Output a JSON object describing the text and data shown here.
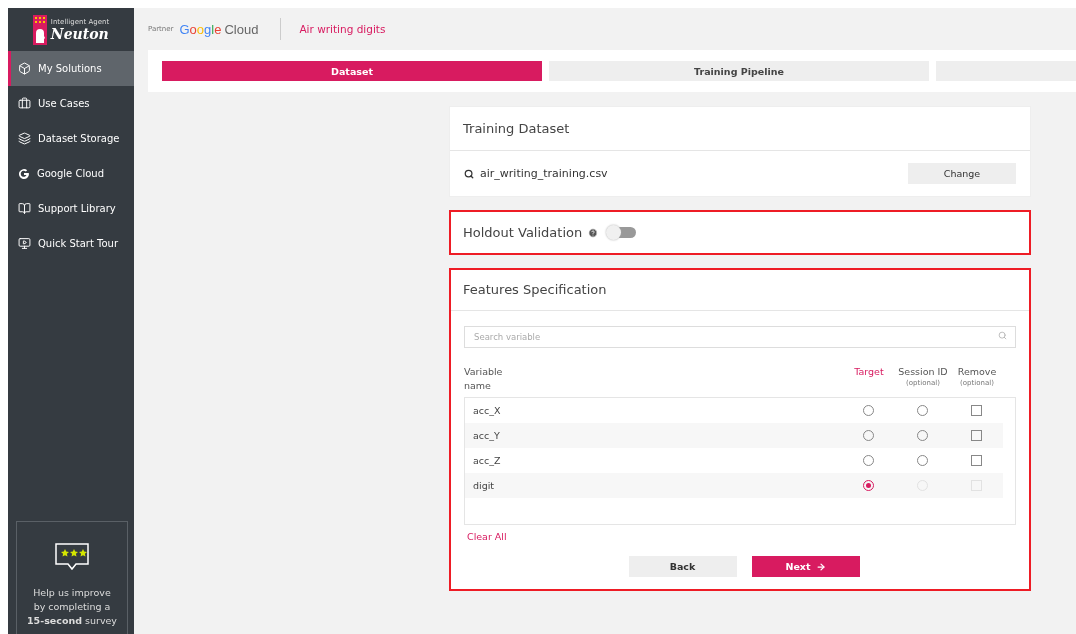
{
  "brand": {
    "tagline": "Intelligent Agent",
    "name": "Neuton"
  },
  "sidebar": {
    "items": [
      {
        "label": "My Solutions",
        "selected": true
      },
      {
        "label": "Use Cases",
        "selected": false
      },
      {
        "label": "Dataset Storage",
        "selected": false
      },
      {
        "label": "Google Cloud",
        "selected": false
      },
      {
        "label": "Support Library",
        "selected": false
      },
      {
        "label": "Quick Start Tour",
        "selected": false
      }
    ],
    "survey": {
      "text": "Help us improve by completing a **15-second** survey"
    }
  },
  "header": {
    "partner": "Partner",
    "partner_logo": "Google",
    "partner_product": "Cloud",
    "project": "Air writing digits"
  },
  "steps": [
    {
      "label": "Dataset",
      "selected": true
    },
    {
      "label": "Training Pipeline",
      "selected": false
    },
    {
      "selected": false
    }
  ],
  "training_dataset": {
    "title": "Training Dataset",
    "file": "air_writing_training.csv",
    "button": "Change"
  },
  "holdout": {
    "title": "Holdout Validation",
    "on": false,
    "highlighted": true
  },
  "features": {
    "title": "Features Specification",
    "highlighted": true,
    "search": {
      "placeholder": "Search variable"
    },
    "columns": [
      {
        "label": "Variable name",
        "accent": false
      },
      {
        "label": "Target",
        "accent": true
      },
      {
        "label": "Session ID",
        "note": "(optional)",
        "accent": false
      },
      {
        "label": "Remove",
        "note": "(optional)",
        "accent": false
      }
    ],
    "rows": [
      {
        "name": "acc_X",
        "target": false,
        "session": false,
        "session_disabled": false,
        "remove": false,
        "remove_disabled": false
      },
      {
        "name": "acc_Y",
        "target": false,
        "session": false,
        "session_disabled": false,
        "remove": false,
        "remove_disabled": false
      },
      {
        "name": "acc_Z",
        "target": false,
        "session": false,
        "session_disabled": false,
        "remove": false,
        "remove_disabled": false
      },
      {
        "name": "digit",
        "target": true,
        "session": false,
        "session_disabled": true,
        "remove": false,
        "remove_disabled": true
      }
    ],
    "clear": "Clear All",
    "back": "Back",
    "next": "Next"
  }
}
